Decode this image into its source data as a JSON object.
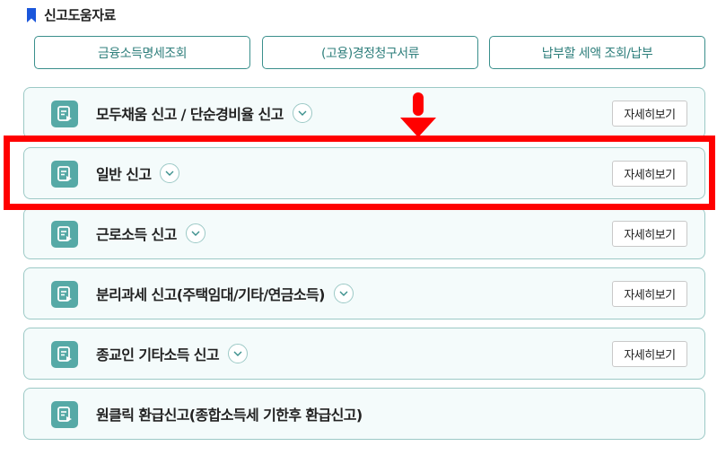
{
  "section": {
    "icon": "bookmark-icon",
    "title": "신고도움자료"
  },
  "help_buttons": [
    {
      "label": "금융소득명세조회"
    },
    {
      "label": "(고용)경정청구서류"
    },
    {
      "label": "납부할 세액 조회/납부"
    }
  ],
  "filing_items": [
    {
      "label": "모두채움 신고 / 단순경비율 신고",
      "has_toggle": true,
      "detail": "자세히보기"
    },
    {
      "label": "일반 신고",
      "has_toggle": true,
      "detail": "자세히보기"
    },
    {
      "label": "근로소득 신고",
      "has_toggle": true,
      "detail": "자세히보기"
    },
    {
      "label": "분리과세 신고(주택임대/기타/연금소득)",
      "has_toggle": true,
      "detail": "자세히보기"
    },
    {
      "label": "종교인 기타소득 신고",
      "has_toggle": true,
      "detail": "자세히보기"
    },
    {
      "label": "원클릭 환급신고(종합소득세 기한후 환급신고)",
      "has_toggle": false
    }
  ],
  "annotation": {
    "highlighted_item": "일반 신고",
    "color": "#ff0000"
  },
  "colors": {
    "accent": "#56a9a6",
    "border": "#9cc9c6",
    "item_bg": "#f4fbfb",
    "bookmark": "#1a56db"
  }
}
